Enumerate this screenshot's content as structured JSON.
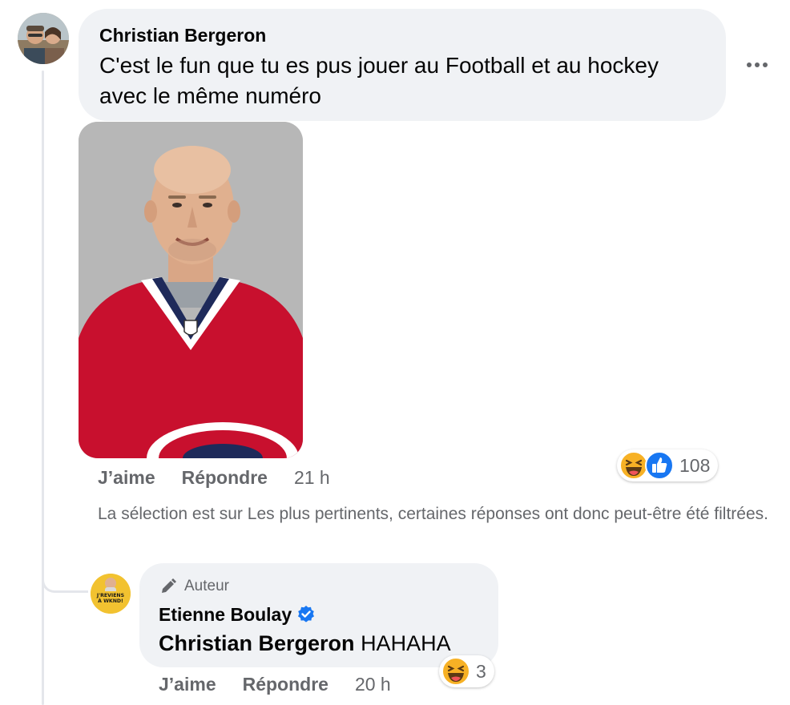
{
  "comment": {
    "author": "Christian Bergeron",
    "text": "C'est le fun que tu es pus jouer au Football et au hockey avec le même numéro",
    "actions": {
      "like": "J’aime",
      "reply": "Répondre",
      "time": "21 h"
    },
    "reactions": {
      "icons": [
        "haha-icon",
        "like-icon"
      ],
      "count": "108"
    }
  },
  "filter_note": "La sélection est sur Les plus pertinents, certaines réponses ont donc peut-être été filtrées.",
  "reply": {
    "badge": "Auteur",
    "author": "Etienne Boulay",
    "mention": "Christian Bergeron",
    "text": "HAHAHA",
    "actions": {
      "like": "J’aime",
      "reply": "Répondre",
      "time": "20 h"
    },
    "reactions": {
      "icons": [
        "haha-icon"
      ],
      "count": "3"
    },
    "avatar_text": [
      "J'REVIENS",
      "À WKND!"
    ]
  },
  "colors": {
    "bubble": "#f0f2f5",
    "muted": "#65676b",
    "verified": "#1877f2",
    "jersey": "#c8102e"
  }
}
